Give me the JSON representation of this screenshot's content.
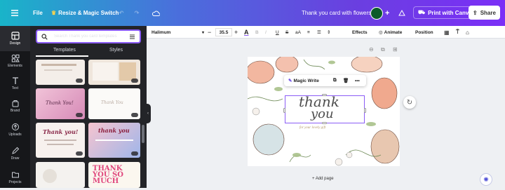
{
  "colors": {
    "accent": "#8b5cf6",
    "rail_bg": "#16171a",
    "panel_bg": "#232428",
    "top_gradient_start": "#19b4c9",
    "top_gradient_end": "#7b2ff7"
  },
  "topbar": {
    "menu_icon": "hamburger-icon",
    "file_label": "File",
    "resize_label": "Resize & Magic Switch",
    "undo_icon": "undo-icon",
    "redo_icon": "redo-icon",
    "cloud_icon": "cloud-icon",
    "doc_title": "Thank you card with flowers",
    "add_icon": "plus-icon",
    "analytics_icon": "chart-icon",
    "print_label": "Print with Canva",
    "share_label": "Share"
  },
  "rail": {
    "items": [
      {
        "label": "Design",
        "icon": "layout-icon"
      },
      {
        "label": "Elements",
        "icon": "shapes-icon"
      },
      {
        "label": "Text",
        "icon": "text-icon"
      },
      {
        "label": "Brand",
        "icon": "brand-icon"
      },
      {
        "label": "Uploads",
        "icon": "upload-icon"
      },
      {
        "label": "Draw",
        "icon": "pen-icon"
      },
      {
        "label": "Projects",
        "icon": "folder-icon"
      }
    ]
  },
  "panel": {
    "search_placeholder": "Search Thank you card templates",
    "tabs": [
      {
        "label": "Templates",
        "active": true
      },
      {
        "label": "Styles",
        "active": false
      }
    ],
    "thumb_texts": {
      "t3": "Thank You!",
      "t4": "Thank You",
      "t5": "Thank you!",
      "t6": "thank you",
      "t8": "THANK YOU SO MUCH"
    }
  },
  "toolbar": {
    "font_name": "Halimum",
    "font_size": "35.5",
    "effects_label": "Effects",
    "animate_label": "Animate",
    "position_label": "Position"
  },
  "canvas": {
    "floating": {
      "magic_write_label": "Magic Write"
    },
    "heading_line1": "thank",
    "heading_line2": "you",
    "subtitle": "for your lovely gift",
    "add_page_label": "+ Add page"
  }
}
